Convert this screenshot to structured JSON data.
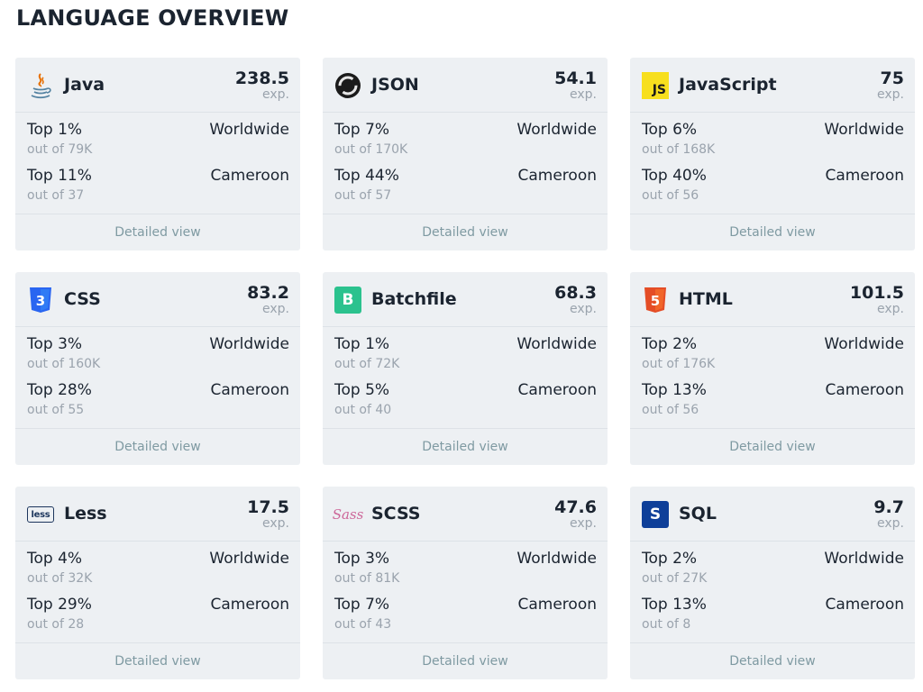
{
  "title": "LANGUAGE OVERVIEW",
  "detail_label": "Detailed view",
  "unit": "exp.",
  "cards": [
    {
      "name": "Java",
      "icon": "java-icon",
      "score": "238.5",
      "worldwide": {
        "top": "Top 1%",
        "out": "out of 79K",
        "region": "Worldwide"
      },
      "country": {
        "top": "Top 11%",
        "out": "out of 37",
        "region": "Cameroon"
      }
    },
    {
      "name": "JSON",
      "icon": "json-icon",
      "score": "54.1",
      "worldwide": {
        "top": "Top 7%",
        "out": "out of 170K",
        "region": "Worldwide"
      },
      "country": {
        "top": "Top 44%",
        "out": "out of 57",
        "region": "Cameroon"
      }
    },
    {
      "name": "JavaScript",
      "icon": "javascript-icon",
      "score": "75",
      "worldwide": {
        "top": "Top 6%",
        "out": "out of 168K",
        "region": "Worldwide"
      },
      "country": {
        "top": "Top 40%",
        "out": "out of 56",
        "region": "Cameroon"
      }
    },
    {
      "name": "CSS",
      "icon": "css-icon",
      "score": "83.2",
      "worldwide": {
        "top": "Top 3%",
        "out": "out of 160K",
        "region": "Worldwide"
      },
      "country": {
        "top": "Top 28%",
        "out": "out of 55",
        "region": "Cameroon"
      }
    },
    {
      "name": "Batchfile",
      "icon": "batchfile-icon",
      "score": "68.3",
      "worldwide": {
        "top": "Top 1%",
        "out": "out of 72K",
        "region": "Worldwide"
      },
      "country": {
        "top": "Top 5%",
        "out": "out of 40",
        "region": "Cameroon"
      }
    },
    {
      "name": "HTML",
      "icon": "html-icon",
      "score": "101.5",
      "worldwide": {
        "top": "Top 2%",
        "out": "out of 176K",
        "region": "Worldwide"
      },
      "country": {
        "top": "Top 13%",
        "out": "out of 56",
        "region": "Cameroon"
      }
    },
    {
      "name": "Less",
      "icon": "less-icon",
      "score": "17.5",
      "worldwide": {
        "top": "Top 4%",
        "out": "out of 32K",
        "region": "Worldwide"
      },
      "country": {
        "top": "Top 29%",
        "out": "out of 28",
        "region": "Cameroon"
      }
    },
    {
      "name": "SCSS",
      "icon": "scss-icon",
      "score": "47.6",
      "worldwide": {
        "top": "Top 3%",
        "out": "out of 81K",
        "region": "Worldwide"
      },
      "country": {
        "top": "Top 7%",
        "out": "out of 43",
        "region": "Cameroon"
      }
    },
    {
      "name": "SQL",
      "icon": "sql-icon",
      "score": "9.7",
      "worldwide": {
        "top": "Top 2%",
        "out": "out of 27K",
        "region": "Worldwide"
      },
      "country": {
        "top": "Top 13%",
        "out": "out of 8",
        "region": "Cameroon"
      }
    }
  ],
  "icon_text": {
    "javascript": "JS",
    "batchfile": "B",
    "sql": "S",
    "less": "less",
    "scss": "Sass",
    "css": "3",
    "html": "5"
  },
  "colors": {
    "card_bg": "#edf0f3",
    "link": "#7f9aa2",
    "muted": "#9aa3ad",
    "text": "#1b2430",
    "js_yellow": "#f7df1e",
    "css_blue": "#2965f1",
    "html_orange": "#e44d26",
    "batch_green": "#2bc28e",
    "sql_blue": "#0e3f99",
    "sass_pink": "#cd6799"
  }
}
